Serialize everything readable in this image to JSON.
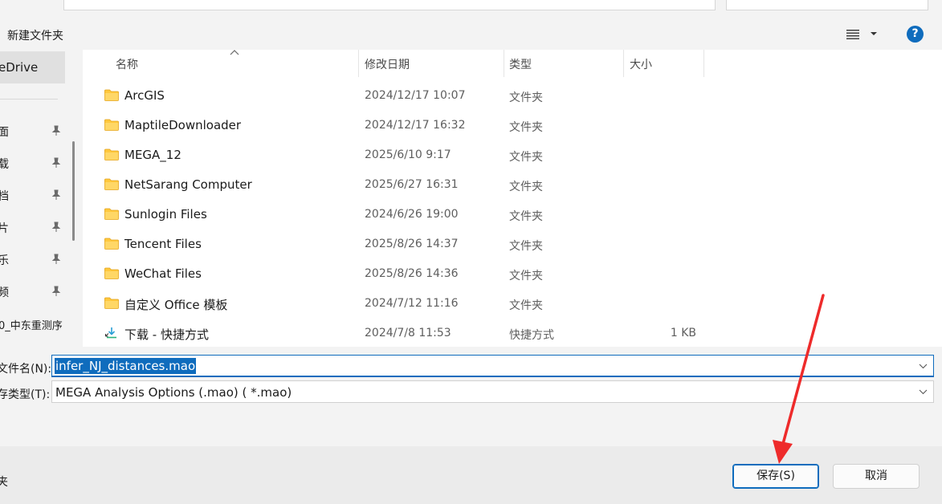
{
  "toolbar": {
    "new_folder_label": "新建文件夹",
    "help_glyph": "?"
  },
  "nav": {
    "onedrive_label": "eDrive",
    "items": [
      {
        "label": "面"
      },
      {
        "label": "载"
      },
      {
        "label": "档"
      },
      {
        "label": "片"
      },
      {
        "label": "乐"
      },
      {
        "label": "频"
      }
    ],
    "long_item_label": "0_中东重测序"
  },
  "columns": {
    "name": "名称",
    "date": "修改日期",
    "type": "类型",
    "size": "大小"
  },
  "files": [
    {
      "name": "ArcGIS",
      "date": "2024/12/17 10:07",
      "type": "文件夹",
      "size": "",
      "icon": "folder-icon"
    },
    {
      "name": "MaptileDownloader",
      "date": "2024/12/17 16:32",
      "type": "文件夹",
      "size": "",
      "icon": "folder-icon"
    },
    {
      "name": "MEGA_12",
      "date": "2025/6/10 9:17",
      "type": "文件夹",
      "size": "",
      "icon": "folder-icon"
    },
    {
      "name": "NetSarang Computer",
      "date": "2025/6/27 16:31",
      "type": "文件夹",
      "size": "",
      "icon": "folder-icon"
    },
    {
      "name": "Sunlogin Files",
      "date": "2024/6/26 19:00",
      "type": "文件夹",
      "size": "",
      "icon": "folder-icon"
    },
    {
      "name": "Tencent Files",
      "date": "2025/8/26 14:37",
      "type": "文件夹",
      "size": "",
      "icon": "folder-icon"
    },
    {
      "name": "WeChat Files",
      "date": "2025/8/26 14:36",
      "type": "文件夹",
      "size": "",
      "icon": "folder-icon"
    },
    {
      "name": "自定义 Office 模板",
      "date": "2024/7/12 11:16",
      "type": "文件夹",
      "size": "",
      "icon": "folder-icon"
    },
    {
      "name": "下载 - 快捷方式",
      "date": "2024/7/8 11:53",
      "type": "快捷方式",
      "size": "1 KB",
      "icon": "shortcut-icon"
    }
  ],
  "form": {
    "filename_label": "文件名(N):",
    "filename_value": "infer_NJ_distances.mao",
    "filetype_label": "存类型(T):",
    "filetype_value": "MEGA Analysis Options (.mao)  ( *.mao)"
  },
  "footer": {
    "hide_folders_label": "夹",
    "save_label": "保存(S)",
    "cancel_label": "取消"
  },
  "colors": {
    "accent": "#0f6cbd",
    "folder": "#ffc83d",
    "annotation_arrow": "#ee2b2b"
  }
}
